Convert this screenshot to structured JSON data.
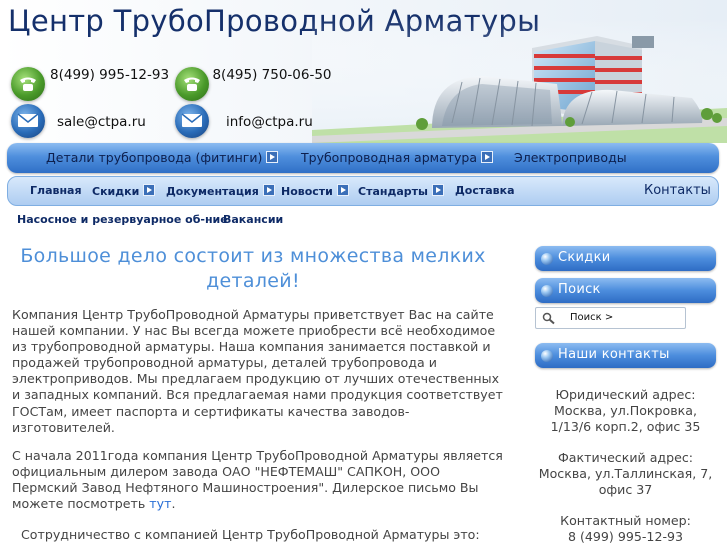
{
  "header": {
    "title": "Центр ТрубоПроводной Арматуры",
    "phone1": "8(499) 995-12-93",
    "phone2": "8(495) 750-06-50",
    "email1": "sale@ctpa.ru",
    "email2": "info@ctpa.ru"
  },
  "nav_primary": [
    {
      "label": "Детали трубопровода (фитинги)",
      "has_submenu": true
    },
    {
      "label": "Трубопроводная арматура",
      "has_submenu": true
    },
    {
      "label": "Электроприводы",
      "has_submenu": false
    }
  ],
  "nav_secondary": [
    {
      "label": "Главная",
      "has_submenu": false
    },
    {
      "label": "Скидки",
      "has_submenu": true
    },
    {
      "label": "Документация",
      "has_submenu": true
    },
    {
      "label": "Новости",
      "has_submenu": true
    },
    {
      "label": "Стандарты",
      "has_submenu": true
    },
    {
      "label": "Доставка",
      "has_submenu": false
    },
    {
      "label": "Контакты",
      "has_submenu": false
    }
  ],
  "nav_tertiary": [
    "Насосное и резервуарное об-ние",
    "Вакансии"
  ],
  "main": {
    "heading": "Большое дело состоит из множества мелких деталей!",
    "paragraph1": "Компания Центр ТрубоПроводной Арматуры приветствует Вас на сайте нашей компании. У нас Вы всегда можете приобрести всё необходимое из трубопроводной арматуры. Наша компания занимается поставкой и продажей трубопроводной арматуры, деталей трубопровода и электроприводов. Мы предлагаем продукцию от лучших отечественных и западных компаний. Вся предлагаемая нами продукция соответствует ГОСТам, имеет паспорта и сертификаты качества заводов-изготовителей.",
    "paragraph2_text": "С начала   2011года компания Центр ТрубоПроводной Арматуры является официальным дилером завода ОАО \"НЕФТЕМАШ\" САПКОН, ООО  Пермский Завод Нефтяного Машиностроения\". Дилерское письмо Вы можете посмотреть ",
    "paragraph2_link": "тут",
    "paragraph2_end": ".",
    "paragraph3": "Сотрудничество с компанией Центр ТрубоПроводной Арматуры это:"
  },
  "sidebar": {
    "discounts_label": "Скидки",
    "search_label": "Поиск",
    "search_placeholder": "Поиск >",
    "contacts_label": "Наши контакты",
    "legal_address": "Юридический адрес: Москва, ул.Покровка, 1/13/6 корп.2, офис 35",
    "actual_address": "Фактический адрес: Москва, ул.Таллинская, 7, офис 37",
    "contact_number_label": "Контактный номер:",
    "contact_number": "8 (499) 995-12-93"
  },
  "colors": {
    "title": "#15306b",
    "heading": "#4e8fd8",
    "nav_blue": "#4f8fdd",
    "nav_light": "#aecdf1",
    "link": "#2a6fd6"
  },
  "icons": [
    "phone-icon",
    "mail-icon",
    "arrow-right-icon",
    "search-icon",
    "bullet-ball-icon"
  ]
}
